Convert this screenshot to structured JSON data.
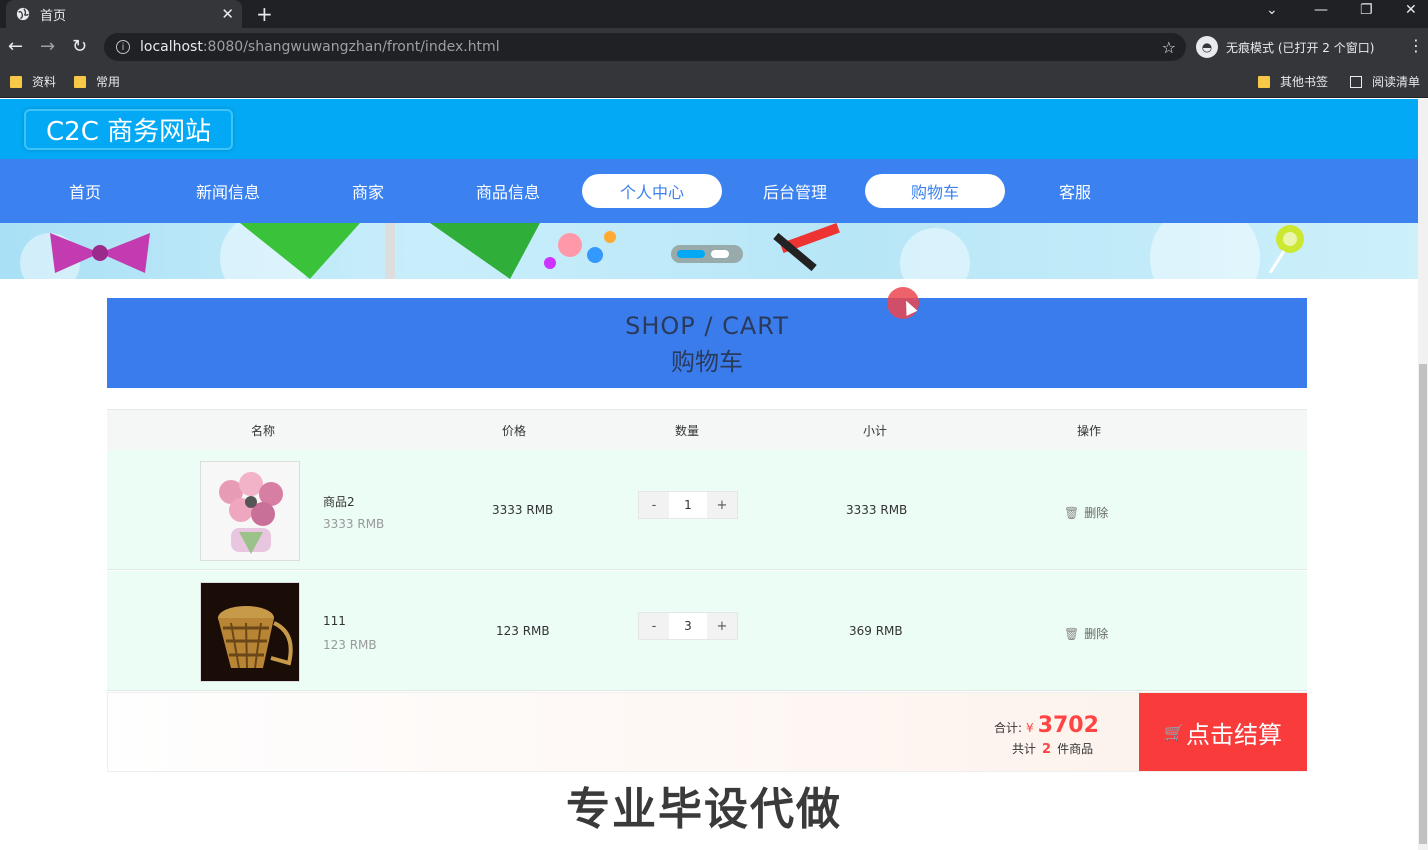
{
  "browser": {
    "tab_title": "首页",
    "url_host": "localhost",
    "url_path": ":8080/shangwuwangzhan/front/index.html",
    "incognito_label": "无痕模式 (已打开 2 个窗口)",
    "bookmarks": [
      "资料",
      "常用"
    ],
    "bookmarks_right": [
      "其他书签",
      "阅读清单"
    ]
  },
  "site": {
    "logo": "C2C 商务网站",
    "nav": [
      {
        "label": "首页",
        "active": false
      },
      {
        "label": "新闻信息",
        "active": false
      },
      {
        "label": "商家",
        "active": false
      },
      {
        "label": "商品信息",
        "active": false
      },
      {
        "label": "个人中心",
        "active": true
      },
      {
        "label": "后台管理",
        "active": false
      },
      {
        "label": "购物车",
        "active": true
      },
      {
        "label": "客服",
        "active": false
      }
    ]
  },
  "cart": {
    "title_en": "SHOP / CART",
    "title_cn": "购物车",
    "columns": [
      "名称",
      "价格",
      "数量",
      "小计",
      "操作"
    ],
    "items": [
      {
        "name": "商品2",
        "price_sub": "3333 RMB",
        "price": "3333 RMB",
        "qty": "1",
        "subtotal": "3333 RMB",
        "action": "删除",
        "minus": "-",
        "plus": "+"
      },
      {
        "name": "111",
        "price_sub": "123 RMB",
        "price": "123 RMB",
        "qty": "3",
        "subtotal": "369 RMB",
        "action": "删除",
        "minus": "-",
        "plus": "+"
      }
    ],
    "total_label": "合计:",
    "currency": "¥",
    "total": "3702",
    "count_prefix": "共计",
    "count": "2",
    "count_suffix": "件商品",
    "checkout_label": "点击结算"
  },
  "watermark": "专业毕设代做",
  "colors": {
    "header": "#03a9f4",
    "nav": "#3b82f0",
    "cart_title_bg": "#3b7ced",
    "row_bg": "#ecfdf6",
    "checkout": "#f93b3b",
    "total": "#ff4444"
  }
}
